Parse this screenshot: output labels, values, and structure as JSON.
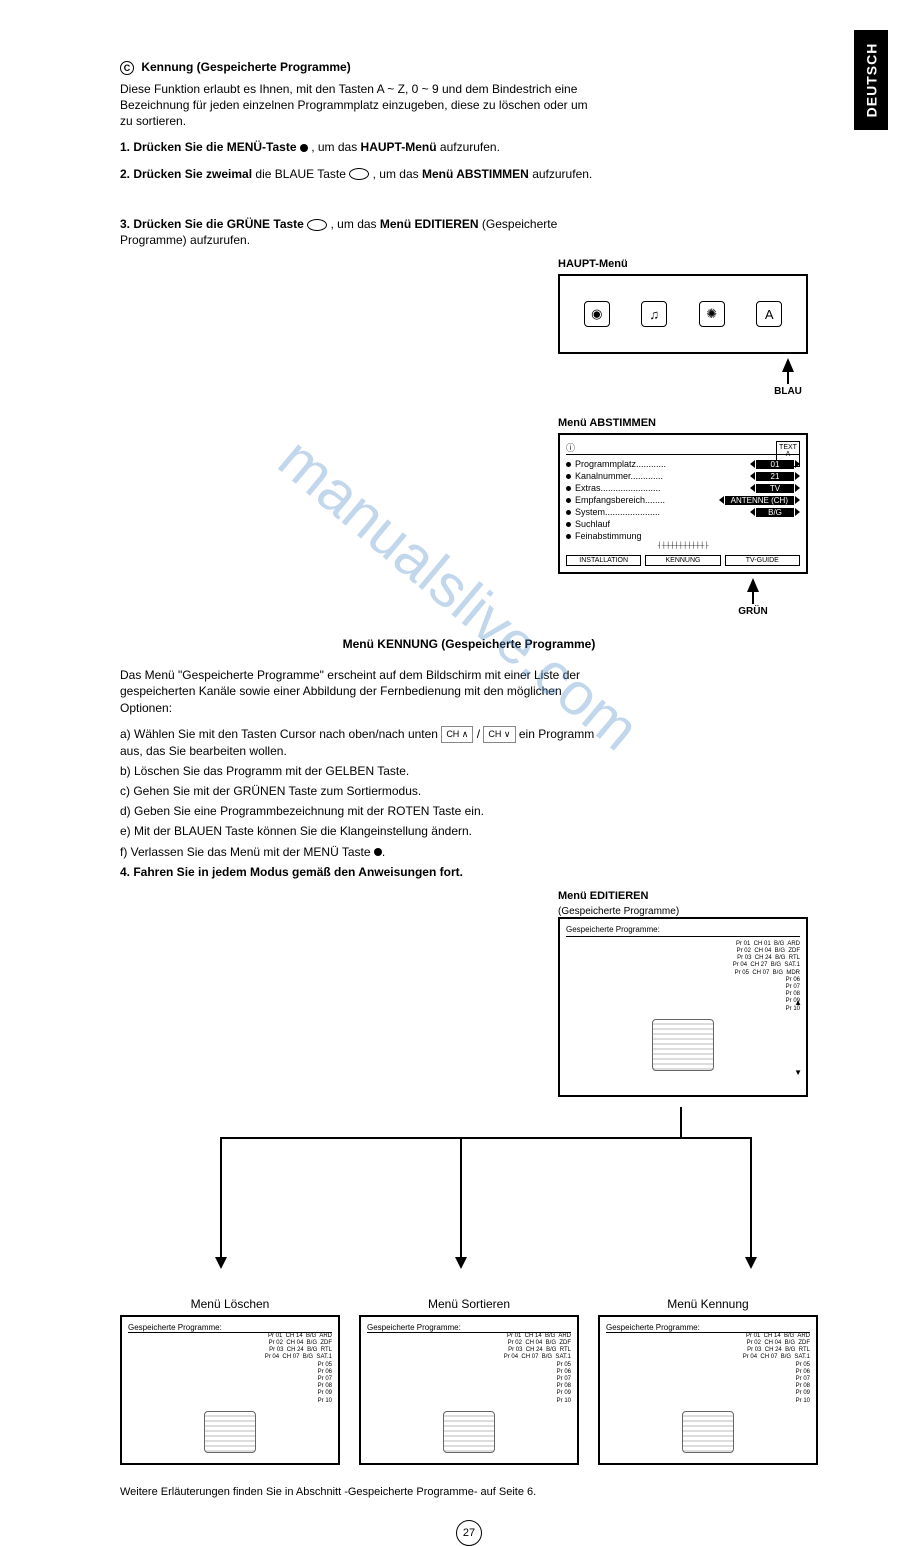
{
  "lang_tab": "DEUTSCH",
  "watermark": "manualslive.com",
  "section_c": {
    "heading": "Kennung (Gespeicherte Programme)",
    "intro": "Diese Funktion erlaubt es Ihnen, mit den Tasten A ~ Z, 0 ~ 9 und dem Bindestrich eine Bezeichnung für jeden einzelnen Programmplatz einzugeben, diese zu löschen oder um zu sortieren.",
    "step1_pre": "1. Drücken Sie die MENÜ-Taste ",
    "step1_post": ", um das ",
    "step1_bold": "HAUPT-Menü",
    "step1_end": " aufzurufen.",
    "step2_pre": "2. Drücken Sie ",
    "step2_bold1": "zweimal",
    "step2_mid": " die BLAUE Taste ",
    "step2_post": ", um das ",
    "step2_bold2": "Menü AB­STIMMEN",
    "step2_end": " aufzurufen.",
    "step3_pre": "3. Drücken Sie die GRÜNE Taste ",
    "step3_post": ", um das ",
    "step3_bold": "Menü EDITIEREN",
    "step3_end": " (Gespeicherte Programme) aufzurufen."
  },
  "haupt": {
    "label": "HAUPT-Menü",
    "arrow_label": "BLAU"
  },
  "abstimmen": {
    "label": "Menü ABSTIMMEN",
    "rows": [
      {
        "label": "Programmplatz............",
        "value": "01"
      },
      {
        "label": "Kanalnummer.............",
        "value": "21"
      },
      {
        "label": "Extras........................",
        "value": "TV"
      },
      {
        "label": "Empfangsbereich........",
        "value": "ANTENNE (CH)"
      },
      {
        "label": "System......................",
        "value": "B/G"
      },
      {
        "label": "Suchlauf",
        "value": ""
      },
      {
        "label": "Feinabstimmung",
        "value": ""
      }
    ],
    "tabs": [
      "INSTALLATION",
      "KENNUNG",
      "TV-GUIDE"
    ],
    "ant_label": "TEXT",
    "arrow_label": "GRÜN"
  },
  "kennung": {
    "title": "Menü KENNUNG (Gespeicherte Programme)",
    "intro": "Das Menü \"Gespeicherte Programme\" erscheint auf dem Bildschirm mit einer Liste der gespeicherten Kanäle sowie einer Abbildung der Fernbedienung mit den möglichen Optionen:",
    "a_pre": "a) Wählen Sie mit den Tasten Cursor nach oben/nach unten ",
    "a_key1": "CH ∧",
    "a_mid": " / ",
    "a_key2": "CH ∨",
    "a_post": " ein Programm aus, das Sie bearbeiten wollen.",
    "b": "b) Löschen Sie das Programm mit der GELBEN Taste.",
    "c": "c) Gehen Sie mit der GRÜNEN Taste zum Sortiermodus.",
    "d": "d) Geben Sie eine Programmbezeichnung mit der ROTEN Taste ein.",
    "e": "e) Mit der BLAUEN Taste können Sie die Klangeinstellung ändern.",
    "f_pre": "f) Verlassen Sie das Menü mit der MENÜ Taste ",
    "step4": "4. Fahren Sie in jedem Modus gemäß den Anweisungen fort."
  },
  "editieren": {
    "label": "Menü EDITIEREN",
    "sub": "(Gespeicherte Programme)",
    "header": "Gespeicherte Programme:",
    "list": "Pr 01  CH 01  B/G  ARD\nPr 02  CH 04  B/G  ZDF\nPr 03  CH 24  B/G  RTL\nPr 04  CH 27  B/G  SAT.1\nPr 05  CH 07  B/G  MDR\nPr 06\nPr 07\nPr 08\nPr 09\nPr 10"
  },
  "sub_menus": {
    "loeschen": {
      "title": "Menü Löschen",
      "header": "Gespeicherte Programme:"
    },
    "sortieren": {
      "title": "Menü Sortieren",
      "header": "Gespeicherte Programme:"
    },
    "kennung": {
      "title": "Menü Kennung",
      "header": "Gespeicherte Programme:"
    },
    "list": "Pr 01  CH 14  B/G  ARD\nPr 02  CH 04  B/G  ZDF\nPr 03  CH 24  B/G  RTL\nPr 04  CH 07  B/G  SAT.1\nPr 05\nPr 06\nPr 07\nPr 08\nPr 09\nPr 10"
  },
  "footer": "Weitere Erläuterungen finden Sie in Abschnitt -Gespeicherte Programme- auf Seite 6.",
  "page_number": "27",
  "copyright_symbol": "C"
}
